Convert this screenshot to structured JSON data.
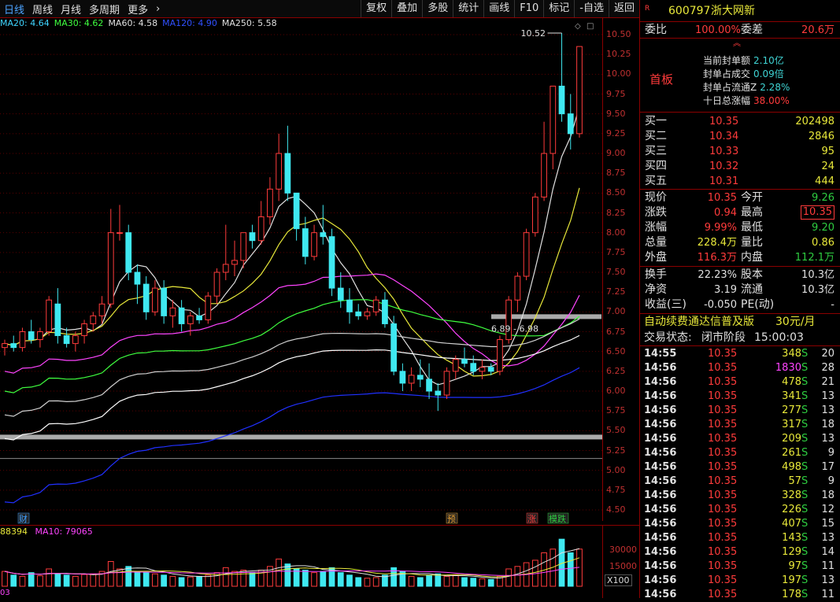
{
  "toolbar": {
    "period_tabs": [
      "日线",
      "周线",
      "月线",
      "多周期",
      "更多"
    ],
    "more_arrow": "›",
    "tools": [
      "复权",
      "叠加",
      "多股",
      "统计",
      "画线",
      "F10",
      "标记",
      "-自选",
      "返回"
    ]
  },
  "ma_legend": [
    {
      "label": "MA20: 4.64",
      "color": "#3fd4ff"
    },
    {
      "label": "MA30: 4.62",
      "color": "#3fff3f"
    },
    {
      "label": "MA60: 4.58",
      "color": "#e0e0e0"
    },
    {
      "label": "MA120: 4.90",
      "color": "#3050ff"
    },
    {
      "label": "MA250: 5.58",
      "color": "#e0e0e0"
    }
  ],
  "price_axis": [
    "10.50",
    "10.25",
    "10.00",
    "9.75",
    "9.50",
    "9.25",
    "9.00",
    "8.75",
    "8.50",
    "8.25",
    "8.00",
    "7.75",
    "7.50",
    "7.25",
    "7.00",
    "6.75",
    "6.50",
    "6.25",
    "6.00",
    "5.75",
    "5.50",
    "5.25",
    "5.00",
    "4.75",
    "4.50"
  ],
  "annotations": {
    "high_label": "10.52",
    "range_label": "6.89 - 6.98",
    "markers": [
      "财",
      "预",
      "涨",
      "模跌"
    ]
  },
  "volume": {
    "legend_a": "88394",
    "legend_b": "MA10: 79065",
    "axis": [
      "30000",
      "15000"
    ],
    "unit": "X100",
    "bottom_label": "03"
  },
  "stock": {
    "flag": "R",
    "code": "600797",
    "name": "浙大网新"
  },
  "weibi": {
    "label1": "委比",
    "value1": "100.00%",
    "label2": "委差",
    "value2": "20.6万"
  },
  "board": {
    "title": "首板",
    "items": [
      {
        "label": "当前封单额",
        "value": "2.10亿"
      },
      {
        "label": "封单占成交",
        "value": "0.09倍"
      },
      {
        "label": "封单占流通Z",
        "value": "2.28%"
      },
      {
        "label": "十日总涨幅",
        "value": "38.00%"
      }
    ]
  },
  "bids": [
    {
      "label": "买一",
      "price": "10.35",
      "vol": "202498"
    },
    {
      "label": "买二",
      "price": "10.34",
      "vol": "2846"
    },
    {
      "label": "买三",
      "price": "10.33",
      "vol": "95"
    },
    {
      "label": "买四",
      "price": "10.32",
      "vol": "24"
    },
    {
      "label": "买五",
      "price": "10.31",
      "vol": "444"
    }
  ],
  "quote": [
    {
      "l1": "现价",
      "v1": "10.35",
      "l2": "今开",
      "v2": "9.26"
    },
    {
      "l1": "涨跌",
      "v1": "0.94",
      "l2": "最高",
      "v2": "10.35"
    },
    {
      "l1": "涨幅",
      "v1": "9.99%",
      "l2": "最低",
      "v2": "9.20"
    },
    {
      "l1": "总量",
      "v1": "228.4万",
      "l2": "量比",
      "v2": "0.86"
    },
    {
      "l1": "外盘",
      "v1": "116.3万",
      "l2": "内盘",
      "v2": "112.1万"
    }
  ],
  "fundamentals": [
    {
      "l1": "换手",
      "v1": "22.23%",
      "l2": "股本",
      "v2": "10.3亿"
    },
    {
      "l1": "净资",
      "v1": "3.19",
      "l2": "流通",
      "v2": "10.3亿"
    },
    {
      "l1": "收益(三)",
      "v1": "-0.050",
      "l2": "PE(动)",
      "v2": "-"
    }
  ],
  "promo": {
    "text": "自动续费通达信普及版",
    "price": "30元/月"
  },
  "trade_status": {
    "label": "交易状态:",
    "value": "闭市阶段",
    "time": "15:00:03"
  },
  "ticks": [
    {
      "t": "14:55",
      "p": "10.35",
      "v": "348",
      "s": "S",
      "n": "20"
    },
    {
      "t": "14:56",
      "p": "10.35",
      "v": "1830",
      "s": "S",
      "n": "28"
    },
    {
      "t": "14:56",
      "p": "10.35",
      "v": "478",
      "s": "S",
      "n": "21"
    },
    {
      "t": "14:56",
      "p": "10.35",
      "v": "341",
      "s": "S",
      "n": "13"
    },
    {
      "t": "14:56",
      "p": "10.35",
      "v": "277",
      "s": "S",
      "n": "13"
    },
    {
      "t": "14:56",
      "p": "10.35",
      "v": "317",
      "s": "S",
      "n": "18"
    },
    {
      "t": "14:56",
      "p": "10.35",
      "v": "209",
      "s": "S",
      "n": "13"
    },
    {
      "t": "14:56",
      "p": "10.35",
      "v": "261",
      "s": "S",
      "n": "9"
    },
    {
      "t": "14:56",
      "p": "10.35",
      "v": "498",
      "s": "S",
      "n": "17"
    },
    {
      "t": "14:56",
      "p": "10.35",
      "v": "57",
      "s": "S",
      "n": "9"
    },
    {
      "t": "14:56",
      "p": "10.35",
      "v": "328",
      "s": "S",
      "n": "18"
    },
    {
      "t": "14:56",
      "p": "10.35",
      "v": "226",
      "s": "S",
      "n": "12"
    },
    {
      "t": "14:56",
      "p": "10.35",
      "v": "407",
      "s": "S",
      "n": "15"
    },
    {
      "t": "14:56",
      "p": "10.35",
      "v": "143",
      "s": "S",
      "n": "13"
    },
    {
      "t": "14:56",
      "p": "10.35",
      "v": "129",
      "s": "S",
      "n": "14"
    },
    {
      "t": "14:56",
      "p": "10.35",
      "v": "97",
      "s": "S",
      "n": "11"
    },
    {
      "t": "14:56",
      "p": "10.35",
      "v": "197",
      "s": "S",
      "n": "13"
    },
    {
      "t": "14:56",
      "p": "10.35",
      "v": "178",
      "s": "S",
      "n": "11"
    }
  ],
  "chart_data": {
    "type": "candlestick",
    "title": "",
    "ylim": [
      4.5,
      10.5
    ],
    "candles": [
      [
        6.55,
        6.65,
        6.45,
        6.6
      ],
      [
        6.6,
        6.7,
        6.5,
        6.55
      ],
      [
        6.55,
        6.8,
        6.5,
        6.75
      ],
      [
        6.75,
        6.9,
        6.6,
        6.65
      ],
      [
        6.65,
        6.8,
        6.55,
        6.75
      ],
      [
        6.75,
        7.2,
        6.7,
        7.15
      ],
      [
        7.1,
        7.3,
        6.6,
        6.7
      ],
      [
        6.7,
        6.8,
        6.55,
        6.6
      ],
      [
        6.6,
        6.75,
        6.5,
        6.7
      ],
      [
        6.7,
        6.9,
        6.6,
        6.85
      ],
      [
        6.85,
        7.0,
        6.75,
        6.95
      ],
      [
        6.95,
        7.2,
        6.85,
        7.1
      ],
      [
        7.1,
        8.3,
        7.05,
        8.0
      ],
      [
        8.0,
        8.35,
        7.9,
        8.0
      ],
      [
        8.0,
        8.1,
        7.4,
        7.5
      ],
      [
        7.5,
        7.6,
        7.1,
        7.35
      ],
      [
        7.35,
        7.45,
        6.9,
        7.0
      ],
      [
        7.0,
        7.4,
        6.95,
        7.3
      ],
      [
        7.3,
        7.4,
        6.85,
        6.95
      ],
      [
        6.95,
        7.15,
        6.8,
        7.05
      ],
      [
        7.05,
        7.15,
        6.75,
        6.85
      ],
      [
        6.85,
        7.0,
        6.7,
        6.95
      ],
      [
        6.95,
        7.05,
        6.85,
        6.9
      ],
      [
        6.9,
        7.25,
        6.85,
        7.2
      ],
      [
        7.2,
        7.55,
        7.1,
        7.5
      ],
      [
        7.5,
        8.1,
        7.4,
        7.6
      ],
      [
        7.6,
        7.9,
        7.45,
        7.65
      ],
      [
        7.65,
        8.0,
        7.55,
        8.0
      ],
      [
        8.0,
        8.1,
        7.8,
        7.9
      ],
      [
        7.9,
        8.4,
        7.85,
        8.2
      ],
      [
        8.2,
        8.7,
        8.1,
        8.55
      ],
      [
        8.55,
        9.25,
        8.4,
        9.0
      ],
      [
        9.0,
        9.35,
        8.4,
        8.5
      ],
      [
        8.5,
        8.45,
        7.9,
        8.05
      ],
      [
        8.05,
        8.2,
        7.6,
        7.7
      ],
      [
        7.7,
        8.1,
        7.65,
        8.0
      ],
      [
        8.0,
        8.35,
        7.85,
        7.95
      ],
      [
        7.95,
        8.05,
        7.2,
        7.3
      ],
      [
        7.3,
        7.5,
        7.05,
        7.15
      ],
      [
        7.15,
        7.3,
        6.85,
        7.0
      ],
      [
        7.0,
        7.1,
        6.9,
        6.95
      ],
      [
        6.95,
        7.05,
        6.9,
        7.0
      ],
      [
        7.0,
        7.2,
        6.95,
        7.15
      ],
      [
        7.15,
        7.25,
        6.8,
        6.85
      ],
      [
        6.85,
        6.95,
        6.2,
        6.25
      ],
      [
        6.25,
        6.35,
        6.0,
        6.1
      ],
      [
        6.1,
        6.3,
        6.0,
        6.2
      ],
      [
        6.2,
        6.4,
        6.05,
        6.15
      ],
      [
        6.15,
        6.35,
        5.9,
        6.0
      ],
      [
        6.0,
        6.1,
        5.75,
        5.95
      ],
      [
        5.95,
        6.3,
        5.9,
        6.25
      ],
      [
        6.25,
        6.45,
        6.15,
        6.4
      ],
      [
        6.4,
        6.55,
        6.3,
        6.35
      ],
      [
        6.35,
        6.45,
        6.2,
        6.25
      ],
      [
        6.25,
        6.4,
        6.15,
        6.3
      ],
      [
        6.3,
        6.35,
        6.2,
        6.25
      ],
      [
        6.25,
        6.7,
        6.2,
        6.65
      ],
      [
        6.65,
        7.2,
        6.6,
        7.15
      ],
      [
        7.15,
        7.5,
        7.0,
        7.45
      ],
      [
        7.45,
        8.05,
        7.4,
        8.0
      ],
      [
        8.0,
        8.5,
        7.95,
        8.45
      ],
      [
        8.45,
        9.4,
        8.4,
        9.0
      ],
      [
        9.0,
        9.85,
        8.8,
        9.85
      ],
      [
        9.85,
        10.52,
        9.4,
        9.5
      ],
      [
        9.5,
        9.75,
        9.05,
        9.25
      ],
      [
        9.25,
        10.35,
        9.2,
        10.35
      ]
    ],
    "ma_lines": [
      {
        "name": "MA5",
        "color": "#e0e0e0"
      },
      {
        "name": "MA10",
        "color": "#e8e83a"
      },
      {
        "name": "MA20",
        "color": "#ff44ff"
      },
      {
        "name": "MA30",
        "color": "#3fff3f"
      },
      {
        "name": "MA60",
        "color": "#cfcfcf"
      },
      {
        "name": "MA120",
        "color": "#2030ff"
      },
      {
        "name": "MA250",
        "color": "#ffffff"
      }
    ],
    "volume": [
      12000,
      9000,
      8000,
      11000,
      8500,
      14000,
      10000,
      9000,
      8000,
      9500,
      10000,
      12000,
      20000,
      14000,
      16000,
      12000,
      11000,
      10000,
      9000,
      8000,
      7000,
      7500,
      8000,
      9000,
      11000,
      15000,
      12000,
      13000,
      11000,
      13000,
      16000,
      22000,
      18000,
      14000,
      13000,
      11000,
      12000,
      15000,
      11000,
      9000,
      7000,
      6500,
      7000,
      9000,
      15000,
      12000,
      8000,
      7000,
      9000,
      10000,
      8000,
      9000,
      7000,
      6500,
      6000,
      5500,
      8000,
      14000,
      16000,
      19000,
      21000,
      27000,
      30000,
      38000,
      27000,
      30000
    ]
  }
}
